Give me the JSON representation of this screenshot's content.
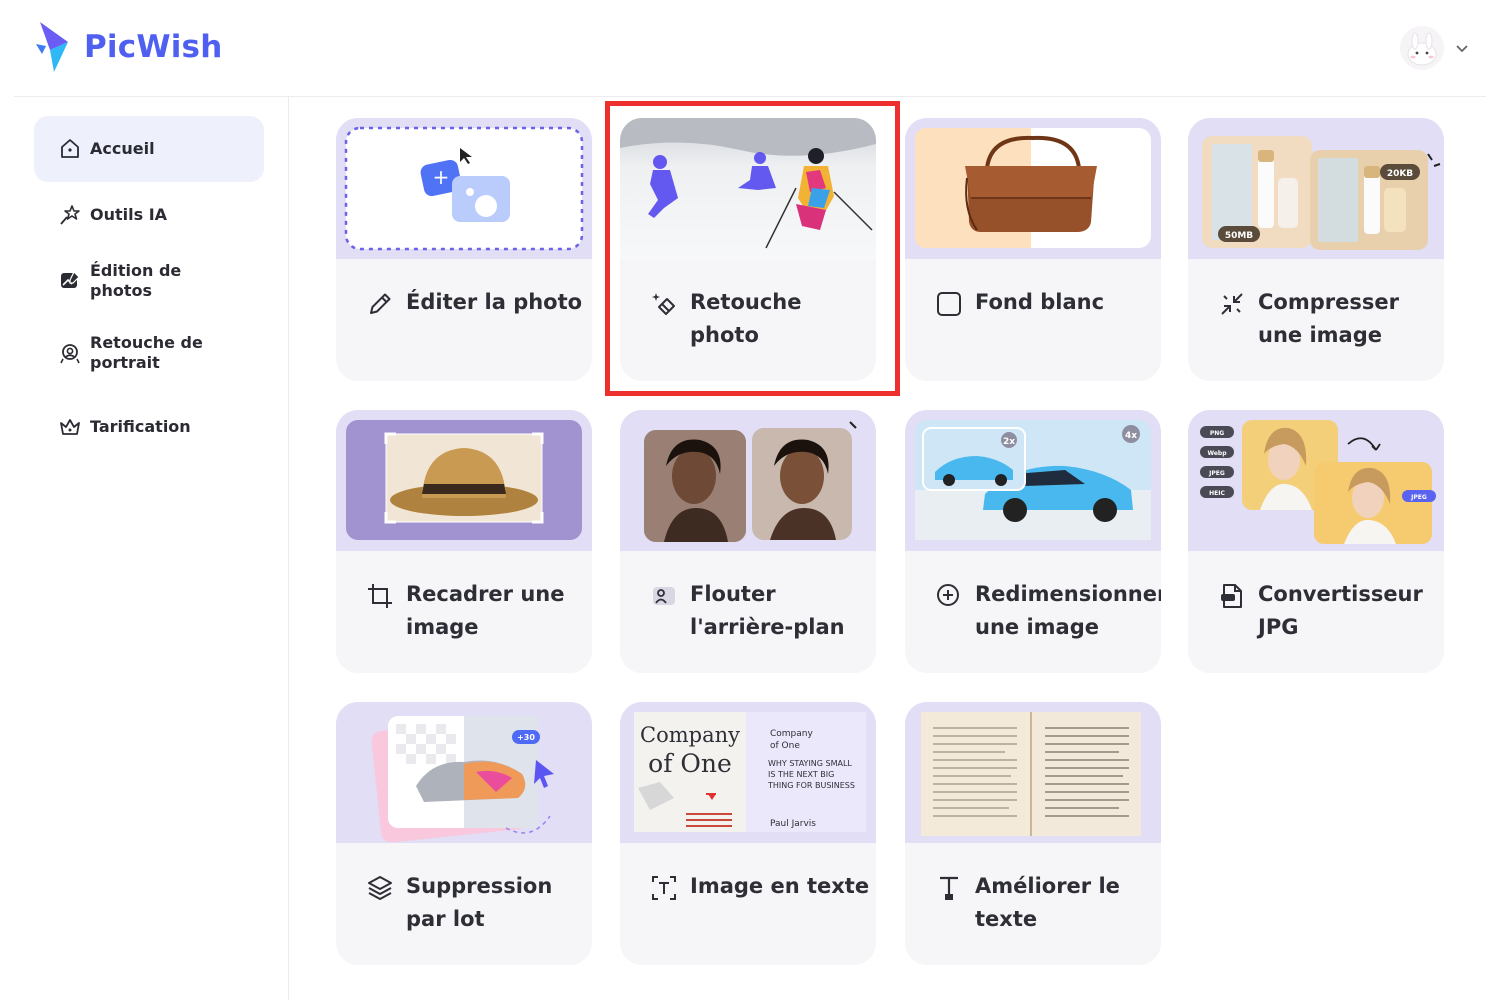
{
  "app": {
    "brand": "PicWish",
    "brand_color": "#4f5ff0"
  },
  "sidebar": {
    "items": [
      {
        "label": "Accueil",
        "icon": "home-icon",
        "active": true
      },
      {
        "label": "Outils IA",
        "icon": "magic-wand-icon",
        "active": false
      },
      {
        "label": "Édition de photos",
        "icon": "photo-edit-icon",
        "active": false
      },
      {
        "label": "Retouche de portrait",
        "icon": "portrait-icon",
        "active": false
      },
      {
        "label": "Tarification",
        "icon": "crown-icon",
        "active": false
      }
    ]
  },
  "tools": [
    {
      "label": "Éditer la photo",
      "icon": "pencil-icon"
    },
    {
      "label": "Retouche photo",
      "icon": "eraser-sparkle-icon"
    },
    {
      "label": "Fond blanc",
      "icon": "square-icon"
    },
    {
      "label": "Compresser une image",
      "icon": "compress-icon"
    },
    {
      "label": "Recadrer une image",
      "icon": "crop-icon"
    },
    {
      "label": "Flouter l'arrière-plan",
      "icon": "blur-icon"
    },
    {
      "label": "Redimensionner une image",
      "icon": "zoom-plus-icon"
    },
    {
      "label": "Convertisseur JPG",
      "icon": "file-convert-icon"
    },
    {
      "label": "Suppression par lot",
      "icon": "layers-icon"
    },
    {
      "label": "Image en texte",
      "icon": "text-scan-icon"
    },
    {
      "label": "Améliorer le texte",
      "icon": "text-hd-icon"
    }
  ],
  "thumb_text": {
    "compress_before": "50MB",
    "compress_after": "20KB",
    "resize_small": "2x",
    "resize_large": "4x",
    "format_png": "PNG",
    "format_webp": "Webp",
    "format_jpeg": "JPEG",
    "format_heic": "HEIC",
    "format_jpeg2": "JPEG",
    "batch_count": "+30",
    "book_title_1": "Company",
    "book_title_2": "of One",
    "book_side_1": "Company",
    "book_side_2": "of One",
    "book_subtitle": "WHY STAYING SMALL IS THE NEXT BIG THING FOR BUSINESS",
    "book_author": "Paul Jarvis"
  },
  "highlight_color": "#ee2f2f"
}
